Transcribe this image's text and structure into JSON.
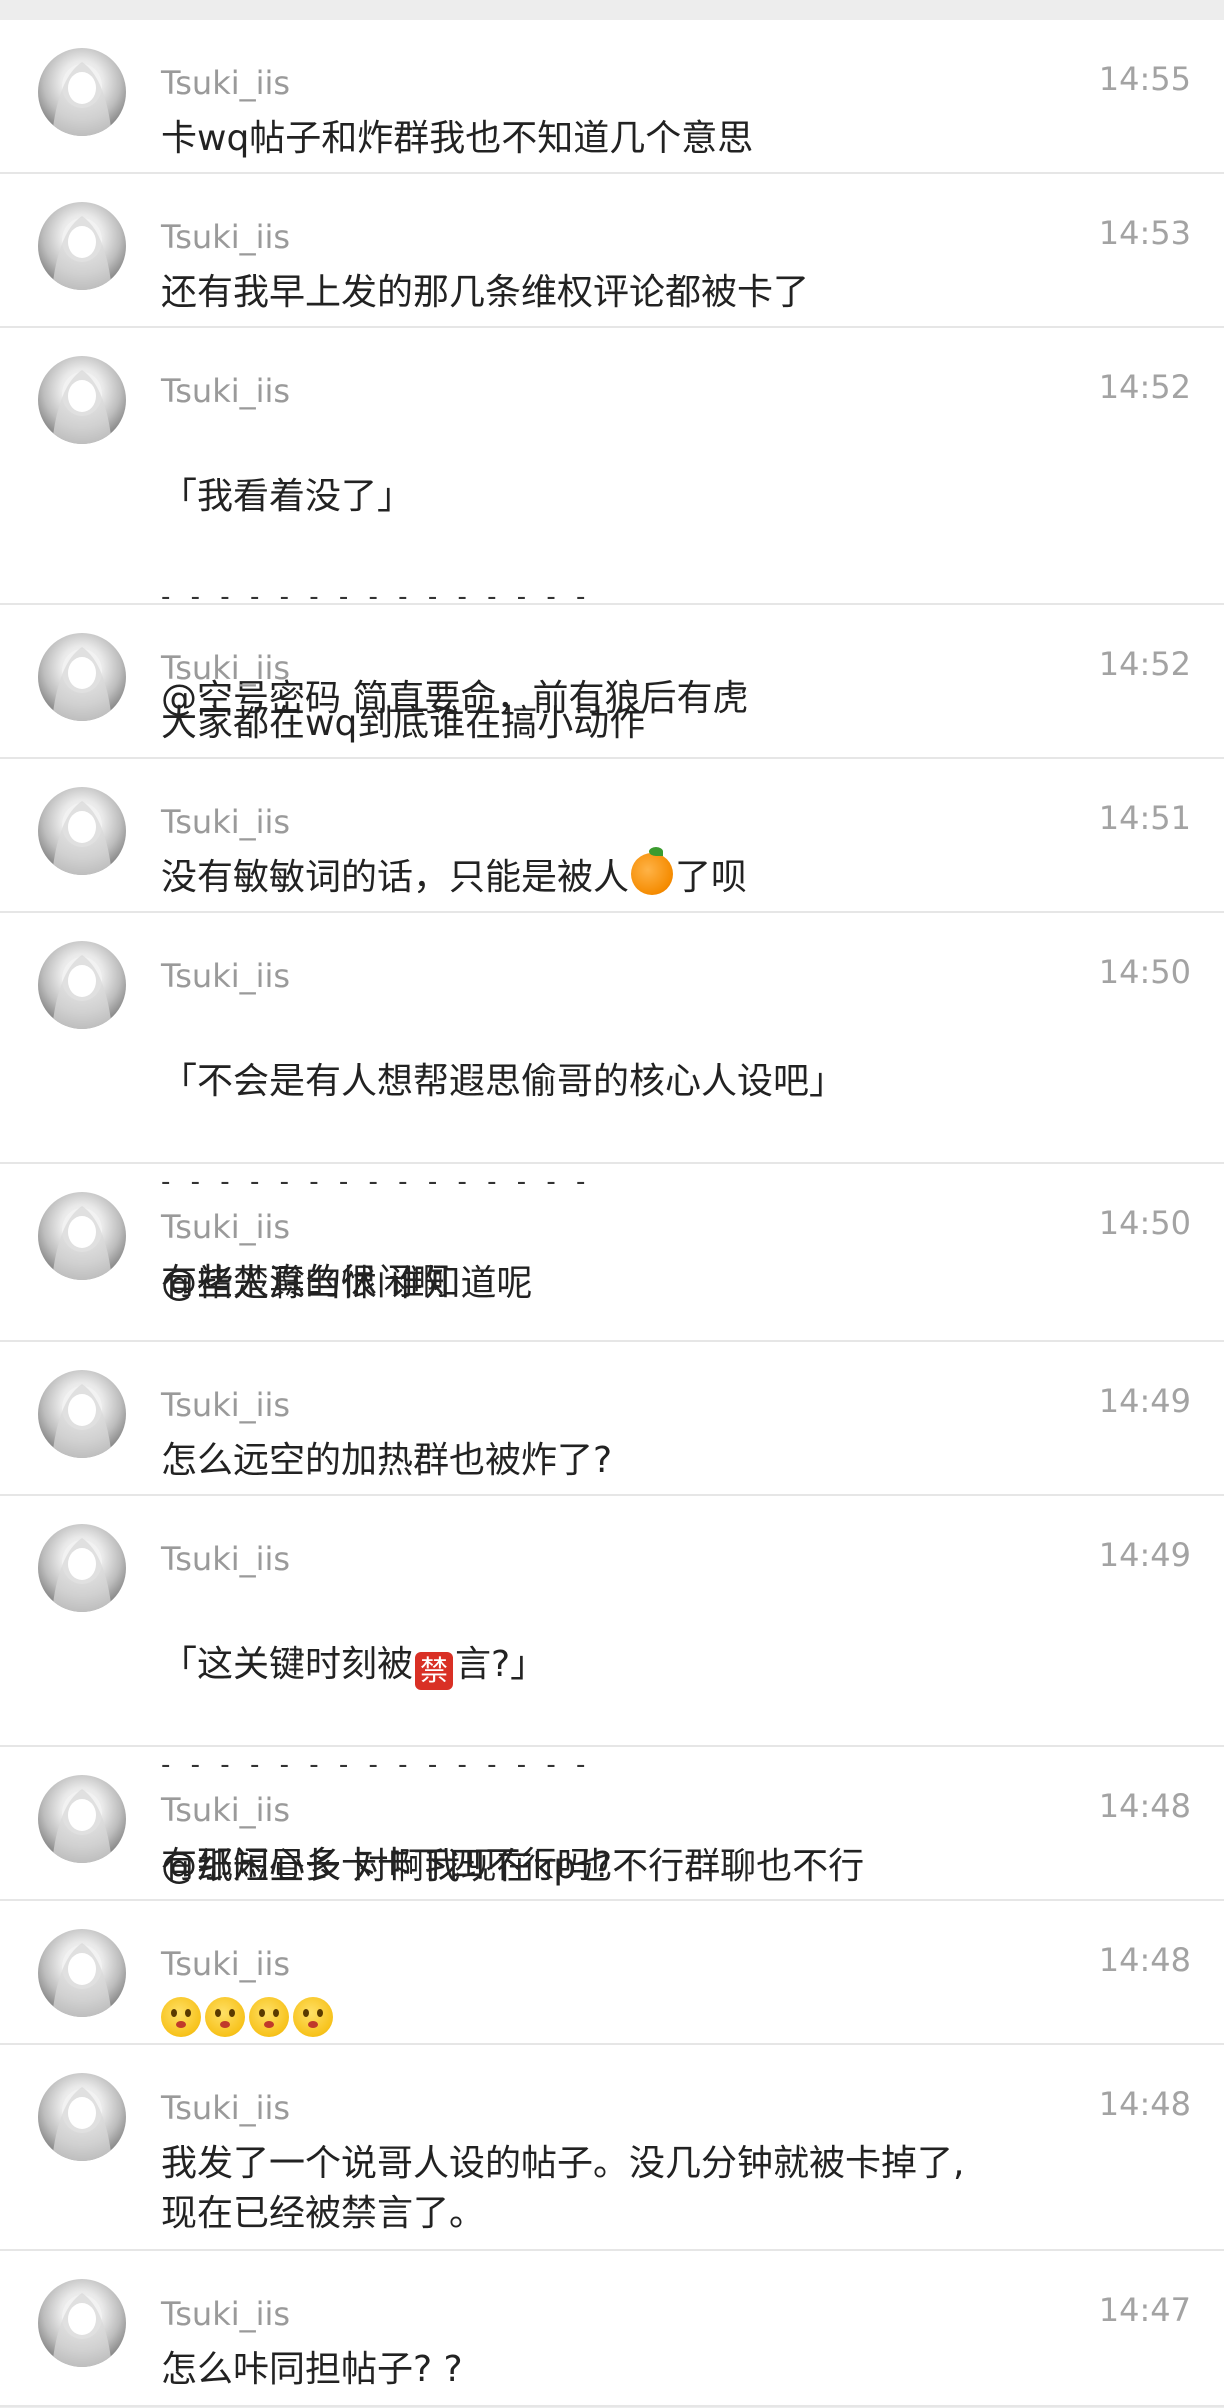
{
  "messages": [
    {
      "name": "Tsuki_iis",
      "time": "14:55",
      "text": "卡wq帖子和炸群我也不知道几个意思"
    },
    {
      "name": "Tsuki_iis",
      "time": "14:53",
      "text": "还有我早上发的那几条维权评论都被卡了"
    },
    {
      "name": "Tsuki_iis",
      "time": "14:52",
      "quote": "「我看着没了」",
      "divider": "- - - - - - - - - - - - - - -",
      "reply": "@空号密码 简直要命，前有狼后有虎"
    },
    {
      "name": "Tsuki_iis",
      "time": "14:52",
      "text": "大家都在wq到底谁在搞小动作"
    },
    {
      "name": "Tsuki_iis",
      "time": "14:51",
      "text_before": "没有敏敏词的话，只能是被人",
      "emoji": "orange-emoji",
      "text_after": "了呗"
    },
    {
      "name": "Tsuki_iis",
      "time": "14:50",
      "quote": "「不会是有人想帮遐思偷哥的核心人设吧」",
      "divider": "- - - - - - - - - - - - - - -",
      "reply": "@褚楚滁刍怵 谁知道呢"
    },
    {
      "name": "Tsuki_iis",
      "time": "14:50",
      "text": "有些人真的很闲啊"
    },
    {
      "name": "Tsuki_iis",
      "time": "14:49",
      "text": "怎么远空的加热群也被炸了?"
    },
    {
      "name": "Tsuki_iis",
      "time": "14:49",
      "quote_before": "「这关键时刻被",
      "ban_char": "禁",
      "quote_after": "言?」",
      "divider": "- - - - - - - - - - - - - - -",
      "reply": "@纸短昼长 对啊我现在kp也不行群聊也不行"
    },
    {
      "name": "Tsuki_iis",
      "time": "14:48",
      "text": "有那闲心多卡卡下四不行吗?"
    },
    {
      "name": "Tsuki_iis",
      "time": "14:48",
      "emoji_row": [
        "smirk-face-emoji",
        "smirk-face-emoji",
        "smirk-face-emoji",
        "smirk-face-emoji"
      ]
    },
    {
      "name": "Tsuki_iis",
      "time": "14:48",
      "text": "我发了一个说哥人设的帖子。没几分钟就被卡掉了,\n现在已经被禁言了。"
    },
    {
      "name": "Tsuki_iis",
      "time": "14:47",
      "text": "怎么咔同担帖子? ?"
    }
  ],
  "colors": {
    "background": "#ededed",
    "card": "#ffffff",
    "name": "#9a9a9a",
    "time": "#a3a3a3",
    "text": "#222222",
    "ban": "#d93025"
  }
}
